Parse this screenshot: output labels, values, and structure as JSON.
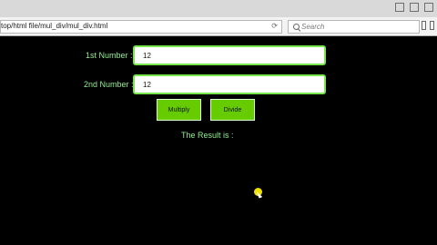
{
  "browser": {
    "address": "top/html file/mul_div/mul_div.html",
    "reload_icon": "reload-icon",
    "search_placeholder": "Search"
  },
  "form": {
    "first_label": "1st Number :",
    "first_value": "12",
    "second_label": "2nd Number :",
    "second_value": "12",
    "multiply_label": "Multiply",
    "divide_label": "Divide",
    "result_label": "The Result is :"
  },
  "colors": {
    "page_background": "#000000",
    "label_text": "#90ee90",
    "input_border": "#79e64d",
    "button_fill": "#66cc00",
    "cursor_highlight": "#efe000"
  }
}
